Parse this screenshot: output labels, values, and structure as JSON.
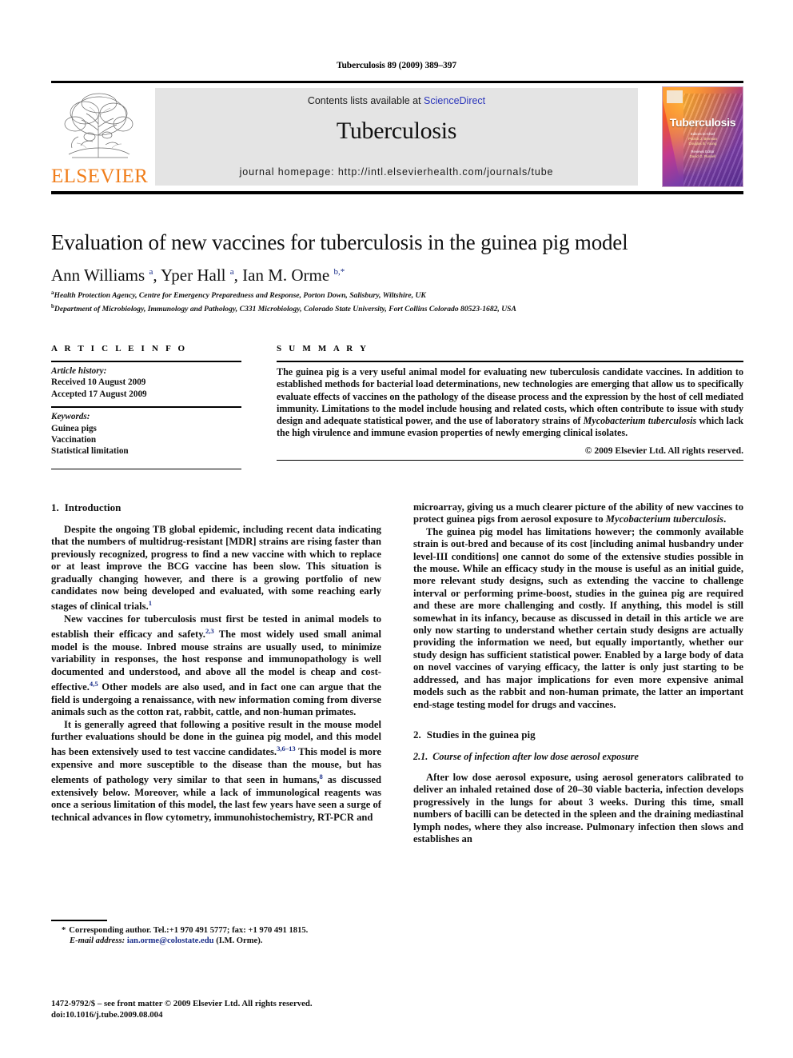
{
  "running_head": "Tuberculosis 89 (2009) 389–397",
  "masthead": {
    "contents_prefix": "Contents lists available at ",
    "sciencedirect_link": "ScienceDirect",
    "journal_title": "Tuberculosis",
    "homepage_label": "journal homepage: http://intl.elsevierhealth.com/journals/tube",
    "publisher_wordmark": "ELSEVIER",
    "publisher_color": "#f07d1a",
    "link_color": "#2b35bb",
    "banner_bg": "#e4e4e4",
    "cover": {
      "title": "Tuberculosis",
      "editors_label_1": "Editors-in-Chief",
      "editors_1": "Patrick J. Brennan\nDouglas B. Young",
      "editors_label_2": "Reviews Editor",
      "editors_2": "David G. Russell"
    }
  },
  "article": {
    "title": "Evaluation of new vaccines for tuberculosis in the guinea pig model",
    "authors_html": "Ann Williams <sup>a</sup>, Yper Hall <sup>a</sup>, Ian M. Orme <sup>b,*</sup>",
    "affiliation_a": "Health Protection Agency, Centre for Emergency Preparedness and Response, Porton Down, Salisbury, Wiltshire, UK",
    "affiliation_b": "Department of Microbiology, Immunology and Pathology, C331 Microbiology, Colorado State University, Fort Collins Colorado 80523-1682, USA",
    "affiliation_a_marker": "a",
    "affiliation_b_marker": "b"
  },
  "article_info": {
    "heading": "A R T I C L E   I N F O",
    "history_label": "Article history:",
    "received": "Received 10 August 2009",
    "accepted": "Accepted 17 August 2009",
    "keywords_label": "Keywords:",
    "keyword_1": "Guinea pigs",
    "keyword_2": "Vaccination",
    "keyword_3": "Statistical limitation"
  },
  "summary": {
    "heading": "S U M M A R Y",
    "text_part_1": "The guinea pig is a very useful animal model for evaluating new tuberculosis candidate vaccines. In addition to established methods for bacterial load determinations, new technologies are emerging that allow us to specifically evaluate effects of vaccines on the pathology of the disease process and the expression by the host of cell mediated immunity. Limitations to the model include housing and related costs, which often contribute to issue with study design and adequate statistical power, and the use of laboratory strains of ",
    "text_italic": "Mycobacterium tuberculosis",
    "text_part_2": " which lack the high virulence and immune evasion properties of newly emerging clinical isolates.",
    "copyright": "© 2009 Elsevier Ltd. All rights reserved."
  },
  "body": {
    "section_1": {
      "num": "1.",
      "title": "Introduction"
    },
    "p1_a": "Despite the ongoing TB global epidemic, including recent data indicating that the numbers of multidrug-resistant [MDR] strains are rising faster than previously recognized, progress to find a new vaccine with which to replace or at least improve the BCG vaccine has been slow. This situation is gradually changing however, and there is a growing portfolio of new candidates now being developed and evaluated, with some reaching early stages of clinical trials.",
    "p1_ref": "1",
    "p2_a": "New vaccines for tuberculosis must first be tested in animal models to establish their efficacy and safety.",
    "p2_ref1": "2,3",
    "p2_b": " The most widely used small animal model is the mouse. Inbred mouse strains are usually used, to minimize variability in responses, the host response and immunopathology is well documented and understood, and above all the model is cheap and cost-effective.",
    "p2_ref2": "4,5",
    "p2_c": " Other models are also used, and in fact one can argue that the field is undergoing a renaissance, with new information coming from diverse animals such as the cotton rat, rabbit, cattle, and non-human primates.",
    "p3_a": "It is generally agreed that following a positive result in the mouse model further evaluations should be done in the guinea pig model, and this model has been extensively used to test vaccine candidates.",
    "p3_ref1": "3,6–13",
    "p3_b": " This model is more expensive and more susceptible to the disease than the mouse, but has elements of pathology very similar to that seen in humans,",
    "p3_ref2": "8",
    "p3_c": " as discussed extensively below. Moreover, while a lack of immunological reagents was once a serious limitation of this model, the last few years have seen a surge of technical advances in flow cytometry, immunohistochemistry, RT-PCR and",
    "p4_a": "microarray, giving us a much clearer picture of the ability of new vaccines to protect guinea pigs from aerosol exposure to ",
    "p4_italic": "Mycobacterium tuberculosis",
    "p4_b": ".",
    "p5": "The guinea pig model has limitations however; the commonly available strain is out-bred and because of its cost [including animal husbandry under level-III conditions] one cannot do some of the extensive studies possible in the mouse. While an efficacy study in the mouse is useful as an initial guide, more relevant study designs, such as extending the vaccine to challenge interval or performing prime-boost, studies in the guinea pig are required and these are more challenging and costly. If anything, this model is still somewhat in its infancy, because as discussed in detail in this article we are only now starting to understand whether certain study designs are actually providing the information we need, but equally importantly, whether our study design has sufficient statistical power. Enabled by a large body of data on novel vaccines of varying efficacy, the latter is only just starting to be addressed, and has major implications for even more expensive animal models such as the rabbit and non-human primate, the latter an important end-stage testing model for drugs and vaccines.",
    "section_2": {
      "num": "2.",
      "title": "Studies in the guinea pig"
    },
    "subsection_2_1": {
      "num": "2.1.",
      "title": "Course of infection after low dose aerosol exposure"
    },
    "p6": "After low dose aerosol exposure, using aerosol generators calibrated to deliver an inhaled retained dose of 20–30 viable bacteria, infection develops progressively in the lungs for about 3 weeks. During this time, small numbers of bacilli can be detected in the spleen and the draining mediastinal lymph nodes, where they also increase. Pulmonary infection then slows and establishes an"
  },
  "footnotes": {
    "corresponding_star": "*",
    "corresponding_text": "Corresponding author. Tel.:+1 970 491 5777; fax: +1 970 491 1815.",
    "email_label": "E-mail address:",
    "email": "ian.orme@colostate.edu",
    "email_attrib": "(I.M. Orme).",
    "issn_line": "1472-9792/$ – see front matter © 2009 Elsevier Ltd. All rights reserved.",
    "doi_line": "doi:10.1016/j.tube.2009.08.004"
  }
}
